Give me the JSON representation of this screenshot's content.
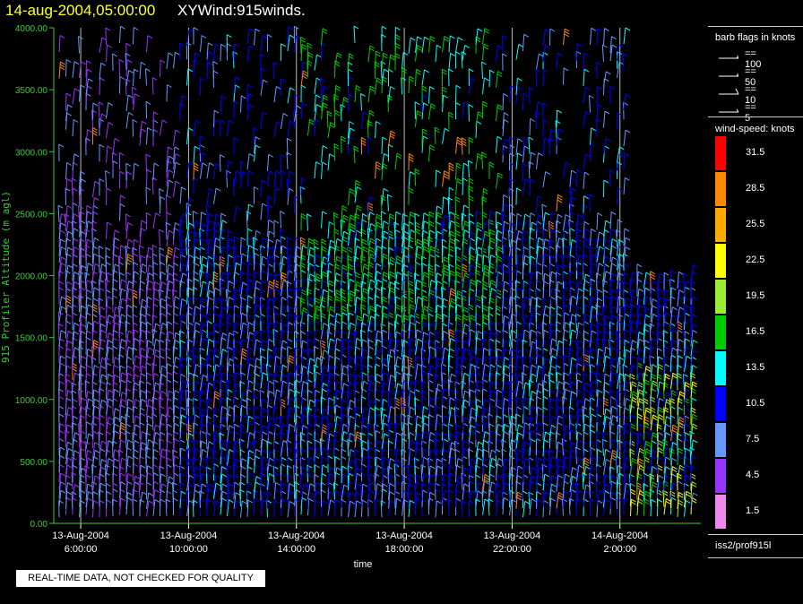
{
  "header": {
    "date": "14-aug-2004,05:00:00",
    "plot_name": "XYWind:915winds."
  },
  "notice": "REAL-TIME DATA, NOT CHECKED FOR QUALITY",
  "source": "iss2/prof915l",
  "chart_data": {
    "type": "wind-barb time-height plot",
    "ylabel": "915 Profiler Altitude (m agl)",
    "xlabel": "time",
    "ylim": [
      0,
      4000
    ],
    "y_ticks": [
      "0.00",
      "500.00",
      "1000.00",
      "1500.00",
      "2000.00",
      "2500.00",
      "3000.00",
      "3500.00",
      "4000.00"
    ],
    "y_tick_values": [
      0,
      500,
      1000,
      1500,
      2000,
      2500,
      3000,
      3500,
      4000
    ],
    "x_ticks": [
      {
        "date": "13-Aug-2004",
        "time": "6:00:00",
        "hours": 6
      },
      {
        "date": "13-Aug-2004",
        "time": "10:00:00",
        "hours": 10
      },
      {
        "date": "13-Aug-2004",
        "time": "14:00:00",
        "hours": 14
      },
      {
        "date": "13-Aug-2004",
        "time": "18:00:00",
        "hours": 18
      },
      {
        "date": "13-Aug-2004",
        "time": "22:00:00",
        "hours": 22
      },
      {
        "date": "14-Aug-2004",
        "time": "2:00:00",
        "hours": 26
      }
    ],
    "xlim_hours": [
      5.0,
      29.0
    ],
    "grid": "vertical lines at time ticks",
    "barb_legend": {
      "title": "barb flags in knots",
      "entries": [
        "== 100",
        "== 50",
        "== 10",
        "== 5"
      ]
    },
    "speed_legend": {
      "title": "wind-speed: knots",
      "levels": [
        {
          "label": "31.5",
          "color": "#ff0000"
        },
        {
          "label": "28.5",
          "color": "#ff8800"
        },
        {
          "label": "25.5",
          "color": "#ffaa00"
        },
        {
          "label": "22.5",
          "color": "#ffff00"
        },
        {
          "label": "19.5",
          "color": "#99ee33"
        },
        {
          "label": "16.5",
          "color": "#00cc00"
        },
        {
          "label": "13.5",
          "color": "#00ffff"
        },
        {
          "label": "10.5",
          "color": "#0000ff"
        },
        {
          "label": "7.5",
          "color": "#6699ff"
        },
        {
          "label": "4.5",
          "color": "#9933ff"
        },
        {
          "label": "1.5",
          "color": "#ee88ee"
        }
      ]
    },
    "colors": {
      "axis": "#33cc33",
      "grid": "#bbbbbb",
      "background": "#000000"
    }
  }
}
